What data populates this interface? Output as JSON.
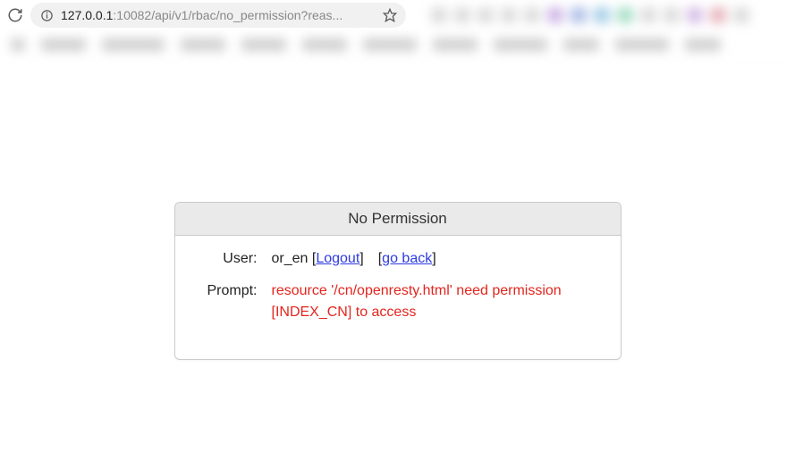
{
  "browser": {
    "url_host_main": "127.0.0.1",
    "url_host_dim": ":10082",
    "url_path": "/api/v1/rbac/no_permission?reas..."
  },
  "panel": {
    "title": "No Permission",
    "user_label": "User:",
    "user_name": "or_en",
    "logout_link": "Logout",
    "goback_link": "go back",
    "prompt_label": "Prompt:",
    "prompt_value": "resource '/cn/openresty.html' need permission [INDEX_CN] to access"
  }
}
